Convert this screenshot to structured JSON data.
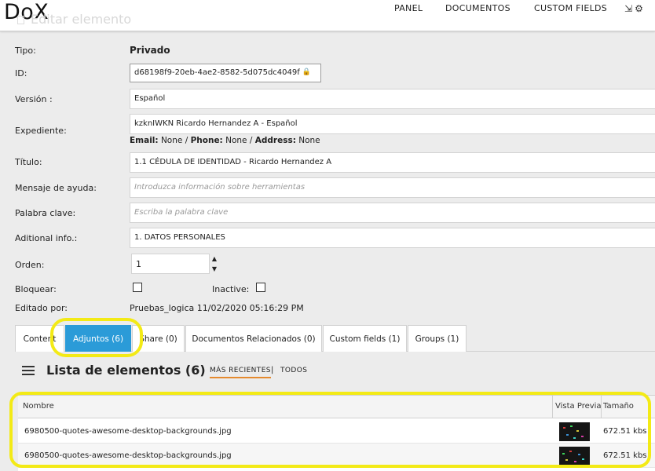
{
  "app": {
    "logo": "DoX",
    "page_title": "Editar elemento"
  },
  "nav": {
    "panel": "PANEL",
    "documents": "DOCUMENTOS",
    "custom_fields": "CUSTOM FIELDS"
  },
  "form": {
    "tipo_label": "Tipo:",
    "tipo_value": "Privado",
    "id_label": "ID:",
    "id_value": "d68198f9-20eb-4ae2-8582-5d075dc4049f",
    "version_label": "Versión :",
    "version_value": "Español",
    "expediente_label": "Expediente:",
    "expediente_value": "kzknIWKN Ricardo Hernandez A - Español",
    "email_label": "Email:",
    "email_value": "None",
    "phone_label": "Phone:",
    "phone_value": "None",
    "address_label": "Address:",
    "address_value": "None",
    "titulo_label": "Título:",
    "titulo_value": "1.1 CÉDULA DE IDENTIDAD - Ricardo Hernandez A",
    "mensaje_label": "Mensaje de ayuda:",
    "mensaje_placeholder": "Introduzca información sobre herramientas",
    "palabra_label": "Palabra clave:",
    "palabra_placeholder": "Escriba la palabra clave",
    "additional_label": "Aditional info.:",
    "additional_value": "1. DATOS PERSONALES",
    "orden_label": "Orden:",
    "orden_value": "1",
    "bloquear_label": "Bloquear:",
    "inactive_label": "Inactive:",
    "editado_label": "Editado por:",
    "editado_value": "Pruebas_logica  11/02/2020 05:16:29 PM"
  },
  "tabs": [
    {
      "label": "Content"
    },
    {
      "label": "Adjuntos (6)"
    },
    {
      "label": "Share (0)"
    },
    {
      "label": "Documentos Relacionados (0)"
    },
    {
      "label": "Custom fields (1)"
    },
    {
      "label": "Groups (1)"
    }
  ],
  "list": {
    "title": "Lista de elementos (6)",
    "filter_recent": "MÁS RECIENTES",
    "separator": "|",
    "filter_all": "TODOS"
  },
  "table": {
    "headers": {
      "name": "Nombre",
      "preview": "Vista Previa",
      "size": "Tamaño"
    },
    "rows": [
      {
        "name": "6980500-quotes-awesome-desktop-backgrounds.jpg",
        "size": "672.51 kbs"
      },
      {
        "name": "6980500-quotes-awesome-desktop-backgrounds.jpg",
        "size": "672.51 kbs"
      }
    ]
  },
  "colors": {
    "active_tab": "#2b9bd8",
    "highlight": "#f3ea16",
    "filter_underline": "#e58a2e"
  },
  "icons": {
    "logout": "logout-icon",
    "settings": "gear-icon",
    "lock": "lock-icon",
    "list": "list-icon"
  }
}
